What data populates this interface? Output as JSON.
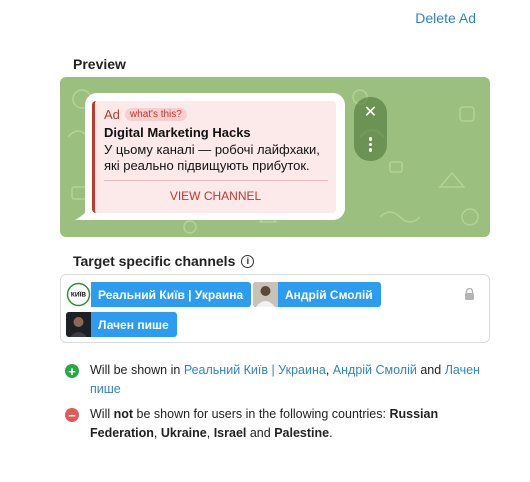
{
  "header": {
    "delete_label": "Delete Ad"
  },
  "preview": {
    "title": "Preview",
    "ad": {
      "label": "Ad",
      "whats_this": "what's this?",
      "title": "Digital Marketing Hacks",
      "description": "У цьому каналі — робочі лайфхаки, які реально підвищують прибуток.",
      "button": "VIEW CHANNEL"
    },
    "close_glyph": "✕"
  },
  "targeting": {
    "title": "Target specific channels",
    "info_glyph": "i",
    "channels": [
      {
        "name": "Реальний Київ | Украина",
        "avatar_text": "КИЇВ"
      },
      {
        "name": "Андрій Смолій"
      },
      {
        "name": "Лачен пише"
      }
    ]
  },
  "summary": {
    "shown_prefix": "Will be shown in",
    "shown_sep": ",",
    "shown_and": "and",
    "not_shown": {
      "p1": "Will",
      "not": "not",
      "p2": "be shown for users in the following countries:",
      "countries": [
        "Russian Federation",
        "Ukraine",
        "Israel",
        "Palestine"
      ],
      "sep": ",",
      "and": "and",
      "end": "."
    },
    "plus_glyph": "+",
    "minus_glyph": "−"
  },
  "colors": {
    "accent": "#2b9cf0",
    "link": "#2e86c1",
    "ad_red": "#c0392b",
    "ok_green": "#27a844",
    "no_red": "#e05a5a"
  }
}
